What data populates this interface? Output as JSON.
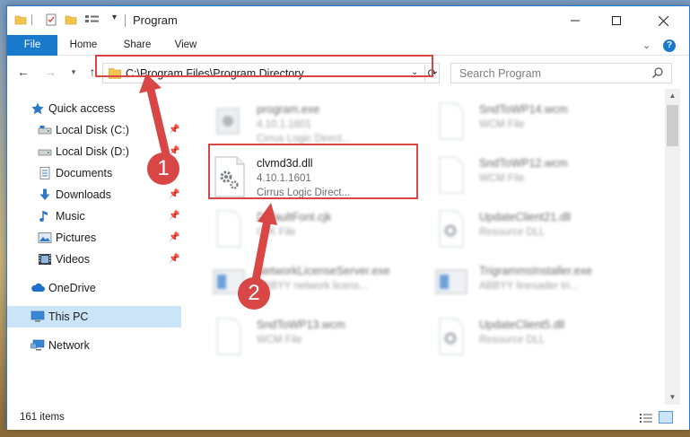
{
  "window": {
    "title": "Program"
  },
  "ribbon": {
    "tabs": [
      "File",
      "Home",
      "Share",
      "View"
    ],
    "help": "?"
  },
  "navigation": {
    "address": "C:\\Program Files\\Program Directory",
    "search_placeholder": "Search Program"
  },
  "sidebar": {
    "items": [
      {
        "label": "Quick access",
        "icon": "star-icon"
      },
      {
        "label": "Local Disk (C:)",
        "icon": "drive-icon",
        "pinned": true
      },
      {
        "label": "Local Disk (D:)",
        "icon": "drive-icon",
        "pinned": true
      },
      {
        "label": "Documents",
        "icon": "documents-icon",
        "pinned": true
      },
      {
        "label": "Downloads",
        "icon": "download-icon",
        "pinned": true
      },
      {
        "label": "Music",
        "icon": "music-icon",
        "pinned": true
      },
      {
        "label": "Pictures",
        "icon": "pictures-icon",
        "pinned": true
      },
      {
        "label": "Videos",
        "icon": "videos-icon",
        "pinned": true
      },
      {
        "label": "OneDrive",
        "icon": "cloud-icon"
      },
      {
        "label": "This PC",
        "icon": "computer-icon",
        "selected": true
      },
      {
        "label": "Network",
        "icon": "network-icon"
      }
    ]
  },
  "files": [
    {
      "name": "program.exe",
      "meta1": "4.10.1.1601",
      "meta2": "Cirrus Logic Direct...",
      "icon": "exe-icon",
      "blurred": true
    },
    {
      "name": "SndToWP14.wcm",
      "meta1": "WCM File",
      "meta2": "",
      "icon": "document-icon",
      "blurred": true
    },
    {
      "name": "clvmd3d.dll",
      "meta1": "4.10.1.1601",
      "meta2": "Cirrus Logic Direct...",
      "icon": "dll-gear-icon",
      "blurred": false
    },
    {
      "name": "SndToWP12.wcm",
      "meta1": "WCM File",
      "meta2": "",
      "icon": "document-icon",
      "blurred": true
    },
    {
      "name": "DefaultFont.cjk",
      "meta1": "CJK File",
      "meta2": "",
      "icon": "document-icon",
      "blurred": true
    },
    {
      "name": "UpdateClient21.dll",
      "meta1": "Resource DLL",
      "meta2": "",
      "icon": "dll-gear-icon",
      "blurred": true
    },
    {
      "name": "NetworkLicenseServer.exe",
      "meta1": "ABBYY network licens...",
      "meta2": "",
      "icon": "app-window-icon",
      "blurred": true
    },
    {
      "name": "TrigrammsInstaller.exe",
      "meta1": "ABBYY linesader tri...",
      "meta2": "",
      "icon": "app-window-icon",
      "blurred": true
    },
    {
      "name": "SndToWP13.wcm",
      "meta1": "WCM File",
      "meta2": "",
      "icon": "document-icon",
      "blurred": true
    },
    {
      "name": "UpdateClient5.dll",
      "meta1": "Resource DLL",
      "meta2": "",
      "icon": "dll-gear-icon",
      "blurred": true
    }
  ],
  "status": {
    "item_count": "161 items"
  },
  "annotations": {
    "callout_1": "1",
    "callout_2": "2",
    "color": "#d94646"
  },
  "colors": {
    "accent": "#1979ca",
    "selection": "#cce4f7",
    "highlight": "#d94646"
  }
}
